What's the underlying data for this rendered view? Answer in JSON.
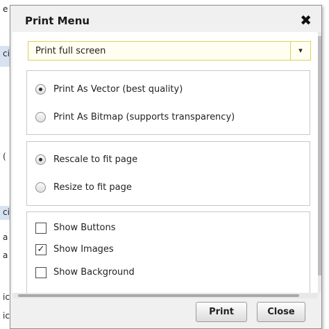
{
  "background": {
    "fragments": [
      "e",
      "ci",
      "(",
      "ci",
      "a",
      "a",
      "ic",
      "ic"
    ]
  },
  "dialog": {
    "title": "Print Menu",
    "close_glyph": "✖",
    "select": {
      "value": "Print full screen",
      "arrow": "▾"
    },
    "render_group": [
      {
        "label": "Print As Vector (best quality)",
        "checked": true
      },
      {
        "label": "Print As Bitmap (supports transparency)",
        "checked": false
      }
    ],
    "scale_group": [
      {
        "label": "Rescale to fit page",
        "checked": true
      },
      {
        "label": "Resize to fit page",
        "checked": false
      }
    ],
    "show_group": [
      {
        "label": "Show Buttons",
        "checked": false
      },
      {
        "label": "Show Images",
        "checked": true
      },
      {
        "label": "Show Background",
        "checked": false
      }
    ],
    "buttons": {
      "print": "Print",
      "close": "Close"
    }
  }
}
